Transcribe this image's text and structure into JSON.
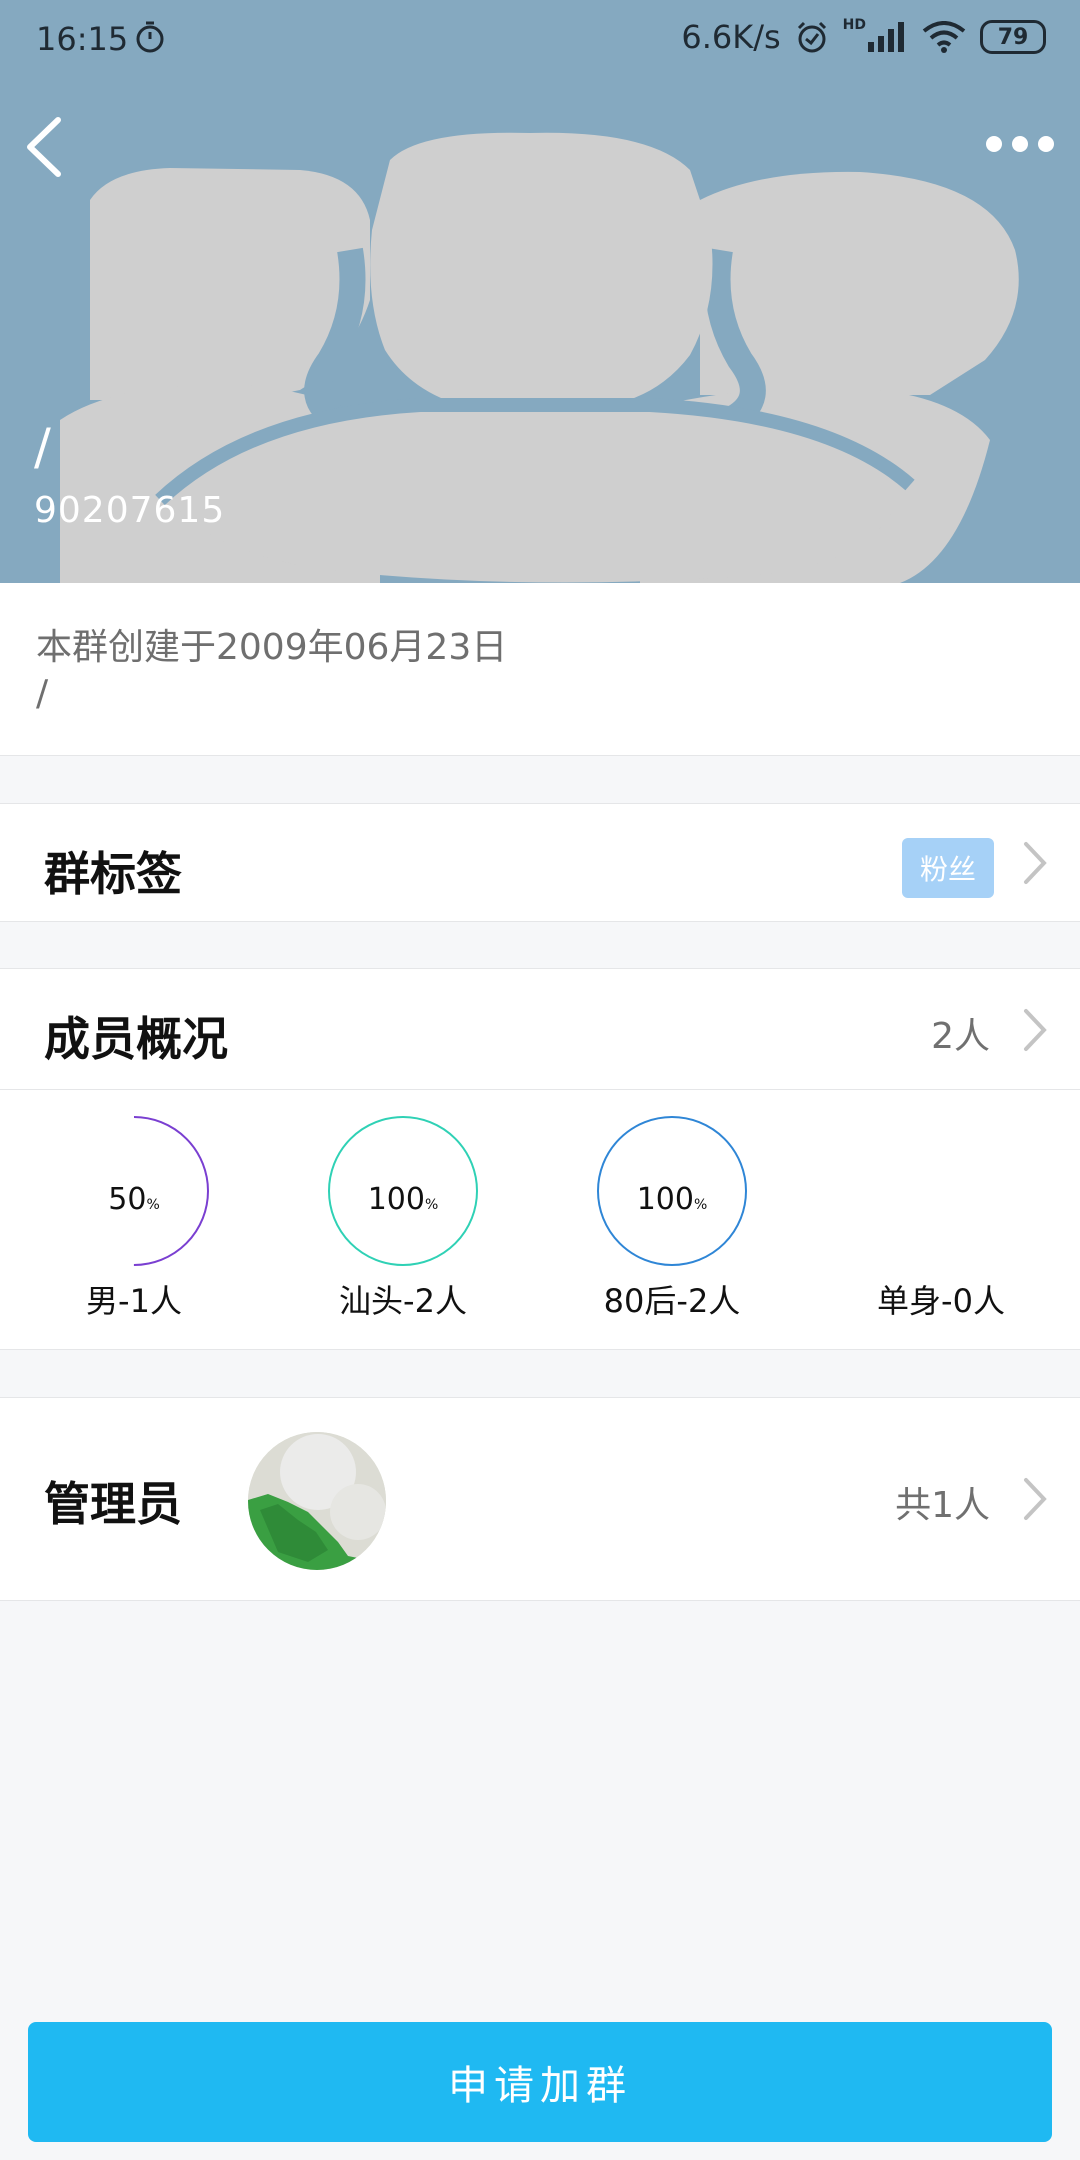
{
  "status_bar": {
    "time": "16:15",
    "network_speed": "6.6K/s",
    "network_type": "HD",
    "battery": "79"
  },
  "header": {
    "group_name": "/",
    "group_id": "90207615",
    "background_color": "#85a9c0"
  },
  "intro": {
    "created_text": "本群创建于2009年06月23日",
    "description": "/"
  },
  "tags_row": {
    "title": "群标签",
    "tag": "粉丝"
  },
  "members_row": {
    "title": "成员概况",
    "count": "2人"
  },
  "member_stats": [
    {
      "percent": "50",
      "unit": "%",
      "label": "男-1人",
      "fraction": 0.5,
      "color": "#7a3fd1"
    },
    {
      "percent": "100",
      "unit": "%",
      "label": "汕头-2人",
      "fraction": 1.0,
      "color": "#2fd1b5"
    },
    {
      "percent": "100",
      "unit": "%",
      "label": "80后-2人",
      "fraction": 1.0,
      "color": "#2f86d6"
    },
    {
      "percent": "",
      "unit": "",
      "label": "单身-0人",
      "fraction": 0,
      "color": "#cccccc"
    }
  ],
  "admin_row": {
    "title": "管理员",
    "count": "共1人"
  },
  "join_button": {
    "label": "申请加群",
    "color": "#1fb9f2"
  },
  "icons": {
    "back": "back-arrow-icon",
    "more": "more-dots-icon",
    "chevron": "chevron-right-icon",
    "timer": "stopwatch-icon",
    "alarm": "alarm-icon",
    "signal": "signal-icon",
    "wifi": "wifi-icon"
  }
}
